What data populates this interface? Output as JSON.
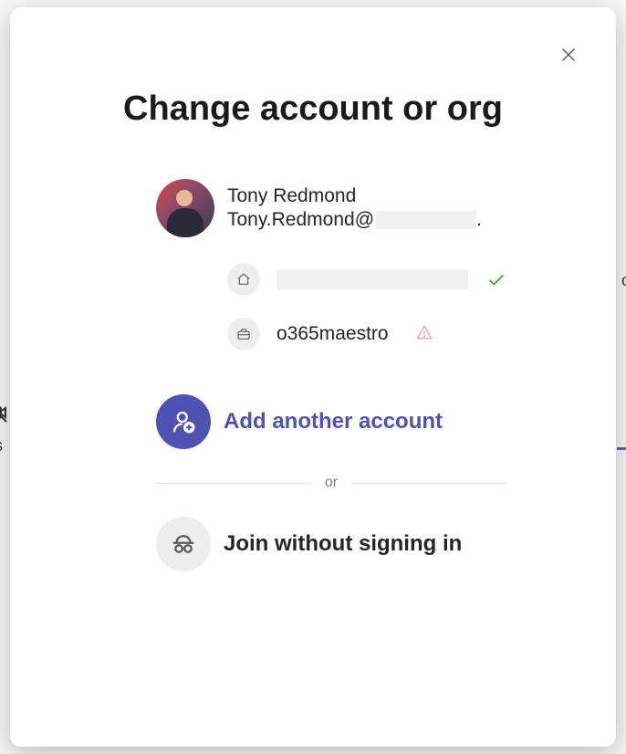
{
  "modal": {
    "title": "Change account or org",
    "account": {
      "name": "Tony Redmond",
      "email_prefix": "Tony.Redmond@",
      "email_suffix": "."
    },
    "orgs": [
      {
        "name": "",
        "redacted": true,
        "icon": "home",
        "status": "active"
      },
      {
        "name": "o365maestro",
        "redacted": false,
        "icon": "briefcase",
        "status": "warning"
      }
    ],
    "add_account_label": "Add another account",
    "divider_label": "or",
    "anonymous_label": "Join without signing in"
  },
  "backdrop": {
    "left_text": "is",
    "right_text": "o"
  }
}
